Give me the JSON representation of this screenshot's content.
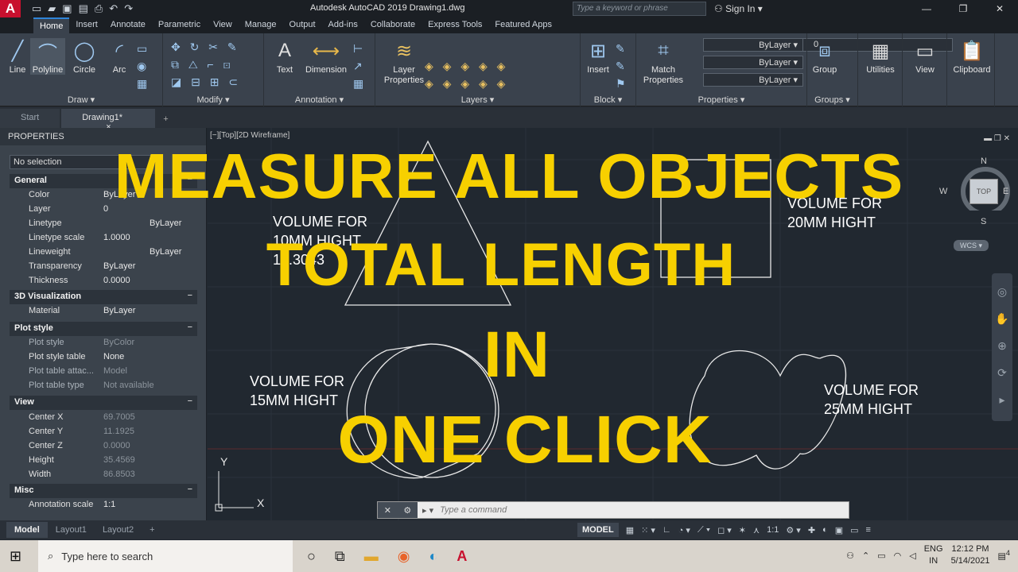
{
  "app": {
    "logo_letter": "A",
    "title": "Autodesk AutoCAD 2019   Drawing1.dwg",
    "search_placeholder": "Type a keyword or phrase",
    "sign_in": "Sign In"
  },
  "ribbon_tabs": [
    "Home",
    "Insert",
    "Annotate",
    "Parametric",
    "View",
    "Manage",
    "Output",
    "Add-ins",
    "Collaborate",
    "Express Tools",
    "Featured Apps"
  ],
  "ribbon": {
    "draw": {
      "label": "Draw",
      "line": "Line",
      "polyline": "Polyline",
      "circle": "Circle",
      "arc": "Arc"
    },
    "modify": {
      "label": "Modify"
    },
    "annotation": {
      "label": "Annotation",
      "text": "Text",
      "dimension": "Dimension"
    },
    "layers": {
      "label": "Layers",
      "layer_properties": "Layer\nProperties",
      "current_layer": "0"
    },
    "block": {
      "label": "Block",
      "insert": "Insert"
    },
    "properties": {
      "label": "Properties",
      "match": "Match\nProperties",
      "color": "ByLayer",
      "linetype": "ByLayer",
      "lineweight": "ByLayer"
    },
    "groups": {
      "label": "Groups",
      "group": "Group"
    },
    "utilities": "Utilities",
    "view": "View",
    "clipboard": "Clipboard"
  },
  "doc_tabs": {
    "start": "Start",
    "drawing": "Drawing1*",
    "close": "×",
    "add": "+"
  },
  "palette": {
    "title": "PROPERTIES",
    "selection": "No selection",
    "general": {
      "title": "General",
      "rows": [
        {
          "k": "Color",
          "v": "ByLayer"
        },
        {
          "k": "Layer",
          "v": "0"
        },
        {
          "k": "Linetype",
          "v": "ByLayer"
        },
        {
          "k": "Linetype scale",
          "v": "1.0000"
        },
        {
          "k": "Lineweight",
          "v": "ByLayer"
        },
        {
          "k": "Transparency",
          "v": "ByLayer"
        },
        {
          "k": "Thickness",
          "v": "0.0000"
        }
      ]
    },
    "viz": {
      "title": "3D Visualization",
      "rows": [
        {
          "k": "Material",
          "v": "ByLayer"
        }
      ]
    },
    "plot": {
      "title": "Plot style",
      "rows": [
        {
          "k": "Plot style",
          "v": "ByColor"
        },
        {
          "k": "Plot style table",
          "v": "None"
        },
        {
          "k": "Plot table attac...",
          "v": "Model"
        },
        {
          "k": "Plot table type",
          "v": "Not available"
        }
      ]
    },
    "view": {
      "title": "View",
      "rows": [
        {
          "k": "Center X",
          "v": "69.7005"
        },
        {
          "k": "Center Y",
          "v": "11.1925"
        },
        {
          "k": "Center Z",
          "v": "0.0000"
        },
        {
          "k": "Height",
          "v": "35.4569"
        },
        {
          "k": "Width",
          "v": "86.8503"
        }
      ]
    },
    "misc": {
      "title": "Misc",
      "rows": [
        {
          "k": "Annotation scale",
          "v": "1:1"
        }
      ]
    }
  },
  "canvas": {
    "viewport_label": "[−][Top][2D Wireframe]",
    "labels": [
      {
        "line1": "VOLUME FOR",
        "line2": "10MM HIGHT",
        "line3": "12.3043"
      },
      {
        "line1": "VOLUME FOR",
        "line2": "20MM HIGHT"
      },
      {
        "line1": "VOLUME FOR",
        "line2": "15MM HIGHT"
      },
      {
        "line1": "VOLUME FOR",
        "line2": "25MM HIGHT"
      }
    ],
    "viewcube": {
      "n": "N",
      "s": "S",
      "e": "E",
      "w": "W",
      "top": "TOP",
      "wcs": "WCS"
    },
    "ucs": {
      "y": "Y",
      "x": "X"
    }
  },
  "overlay": {
    "line1": "MEASURE ALL OBJECTS",
    "line2": "TOTAL LENGTH",
    "line3": "IN",
    "line4": "ONE CLICK",
    "color": "#F7D000"
  },
  "command": {
    "placeholder": "Type a command"
  },
  "layout_tabs": [
    "Model",
    "Layout1",
    "Layout2",
    "+"
  ],
  "status": {
    "model": "MODEL",
    "scale": "1:1"
  },
  "taskbar": {
    "search": "Type here to search",
    "lang1": "ENG",
    "lang2": "IN",
    "time": "12:12 PM",
    "date": "5/14/2021",
    "notif": "4"
  }
}
